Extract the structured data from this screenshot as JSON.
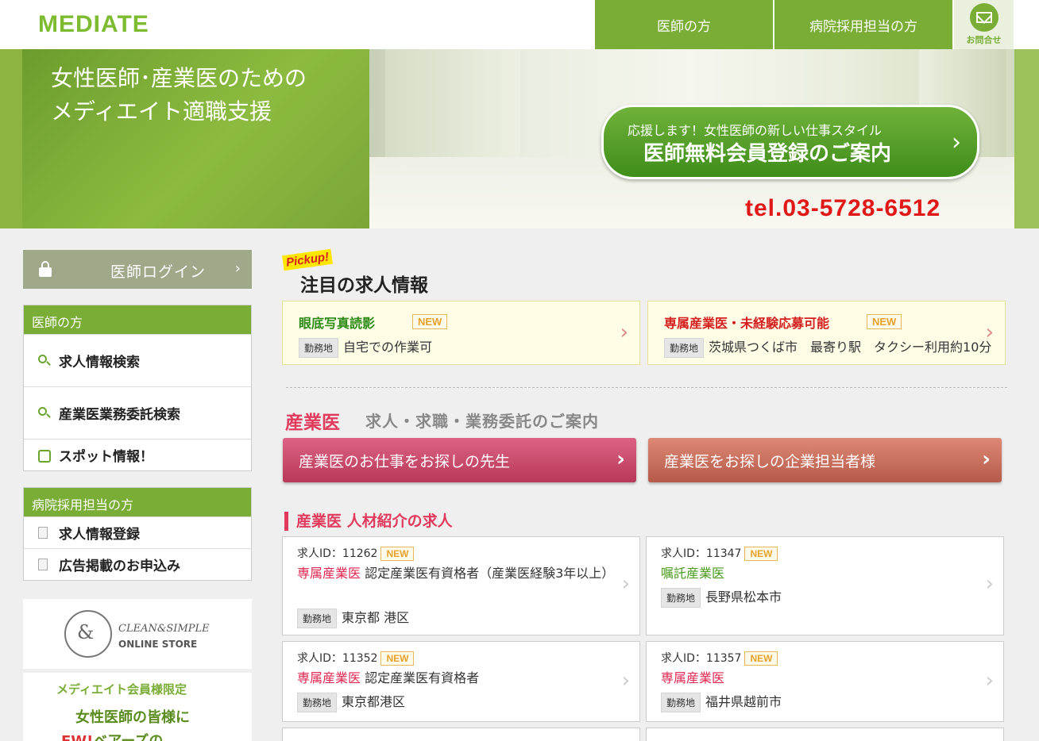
{
  "header": {
    "logo": "MEDIATE",
    "nav_doctor": "医師の方",
    "nav_hospital": "病院採用担当の方",
    "nav_contact": "お問合せ"
  },
  "hero": {
    "line1": "女性医師･産業医のための",
    "line2": "メディエイト適職支援",
    "cta_sub": "応援します！女性医師の新しい仕事スタイル",
    "cta_main": "医師無料会員登録のご案内",
    "tel": "tel.03-5728-6512"
  },
  "sidebar": {
    "login": "医師ログイン",
    "doctor_head": "医師の方",
    "doctor_items": [
      "求人情報検索",
      "産業医業務委託検索",
      "スポット情報！"
    ],
    "hospital_head": "病院採用担当の方",
    "hospital_items": [
      "求人情報登録",
      "広告掲載のお申込み"
    ],
    "promo1_t1": "CLEAN&SIMPLE",
    "promo1_t2": "ONLINE STORE",
    "promo2_t1": "メディエイト会員様限定",
    "promo2_t2": "女性医師の皆様に",
    "promo2_t3_new": "EW!",
    "promo2_t3": "ベアーズの"
  },
  "pickup": {
    "badge": "Pickup!",
    "title": "注目の求人情報",
    "new_label": "NEW",
    "loc_tag": "勤務地",
    "cards": [
      {
        "title": "眼底写真読影",
        "loc": "自宅での作業可"
      },
      {
        "title": "専属産業医・未経験応募可能",
        "loc": "茨城県つくば市　最寄り駅　タクシー利用約10分"
      }
    ]
  },
  "sangyo": {
    "title": "産業医",
    "subtitle": "求人・求職・業務委託のご案内",
    "btn_doctor": "産業医のお仕事をお探しの先生",
    "btn_company": "産業医をお探しの企業担当者様"
  },
  "jobs": {
    "heading": "産業医 人材紹介の求人",
    "id_prefix": "求人ID：",
    "new_label": "NEW",
    "loc_tag": "勤務地",
    "items": [
      {
        "id": "11262",
        "category": "専属産業医",
        "detail": "認定産業医有資格者（産業医経験3年以上）",
        "loc": "東京都 港区"
      },
      {
        "id": "11347",
        "category": "嘱託産業医",
        "detail": "",
        "loc": "長野県松本市"
      },
      {
        "id": "11352",
        "category": "専属産業医",
        "detail": "認定産業医有資格者",
        "loc": "東京都港区"
      },
      {
        "id": "11357",
        "category": "専属産業医",
        "detail": "",
        "loc": "福井県越前市"
      }
    ]
  }
}
